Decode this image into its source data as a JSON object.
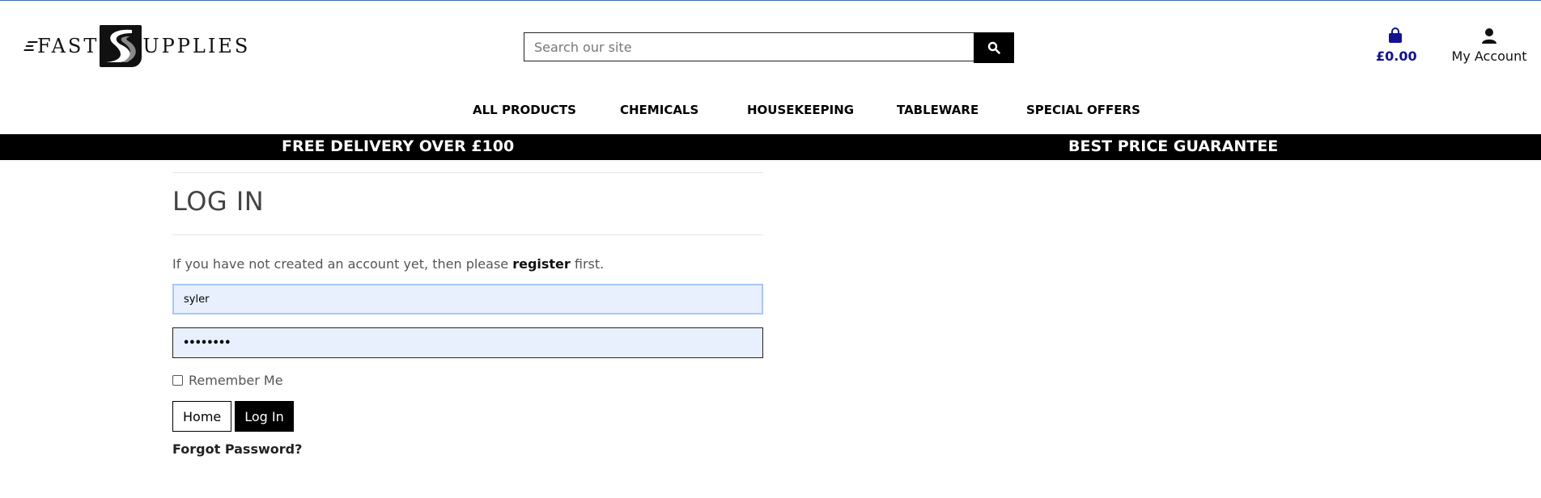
{
  "brand": {
    "name_left": "FAST",
    "name_right": "UPPLIES",
    "logo_letter": "S"
  },
  "search": {
    "placeholder": "Search our site",
    "value": ""
  },
  "cart": {
    "total": "£0.00"
  },
  "account": {
    "label": "My Account"
  },
  "nav": {
    "items": [
      "ALL PRODUCTS",
      "CHEMICALS",
      "HOUSEKEEPING",
      "TABLEWARE",
      "SPECIAL OFFERS"
    ]
  },
  "promo": {
    "left": "FREE DELIVERY OVER £100",
    "right": "BEST PRICE GUARANTEE"
  },
  "login": {
    "title": "LOG IN",
    "notice_before": "If you have not created an account yet, then please ",
    "notice_link": "register",
    "notice_after": " first.",
    "username_value": "syler",
    "password_value": "••••••••",
    "remember_label": "Remember Me",
    "home_button": "Home",
    "login_button": "Log In",
    "forgot_link": "Forgot Password?"
  },
  "colors": {
    "accent": "#121292",
    "promo_bg": "#000000",
    "field_bg": "#e8f0fe"
  }
}
